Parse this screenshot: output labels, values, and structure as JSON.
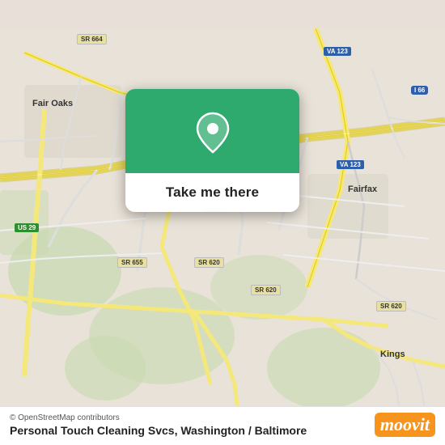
{
  "map": {
    "attribution": "© OpenStreetMap contributors",
    "place_name": "Personal Touch Cleaning Svcs, Washington / Baltimore"
  },
  "popup": {
    "button_label": "Take me there"
  },
  "moovit": {
    "logo_letter": "moovit"
  },
  "road_labels": {
    "i66_top": "I 66",
    "i66_mid": "I 66",
    "i66_right": "I 66",
    "sr664": "SR 664",
    "sr655_top": "SR 655",
    "sr655_bot": "SR 655",
    "sr620_left": "SR 620",
    "sr620_mid": "SR 620",
    "sr620_right": "SR 620",
    "va123_top": "VA 123",
    "va123_mid": "VA 123",
    "us29": "US 29",
    "fairfax": "Fairfax",
    "fair_oaks": "Fair Oaks",
    "kings": "Kings"
  }
}
